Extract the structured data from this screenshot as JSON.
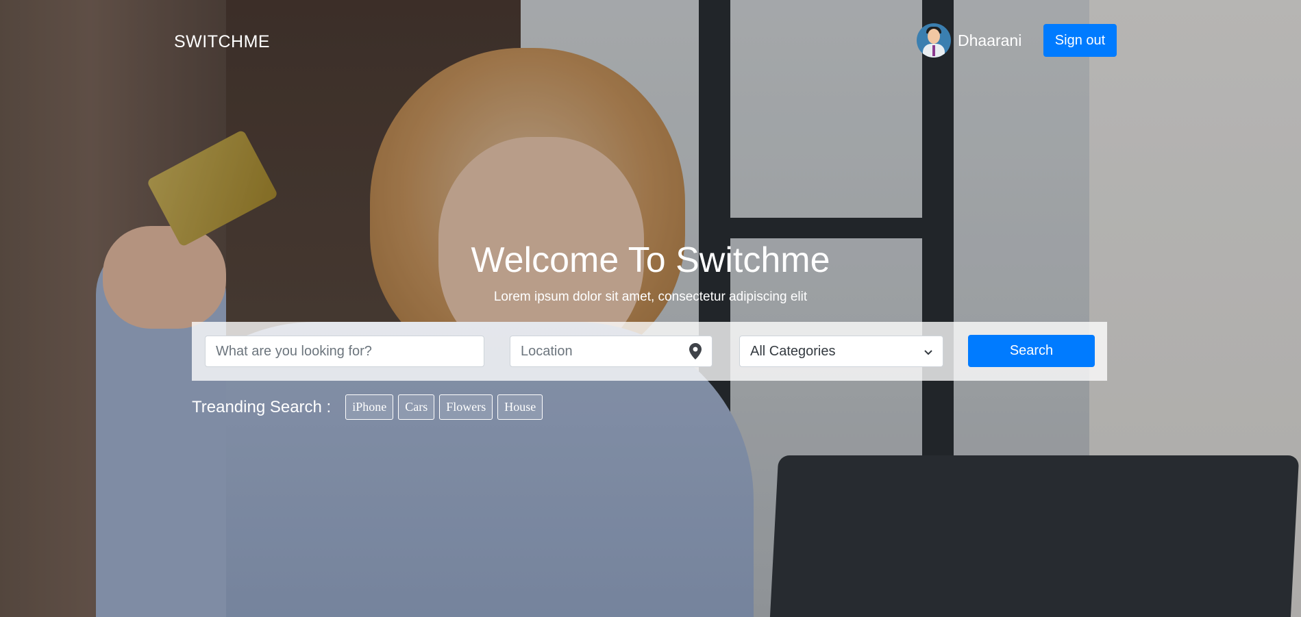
{
  "header": {
    "brand": "SWITCHME",
    "user_name": "Dhaarani",
    "signout_label": "Sign out"
  },
  "hero": {
    "title": "Welcome To Switchme",
    "subtitle": "Lorem ipsum dolor sit amet, consectetur adipiscing elit"
  },
  "search": {
    "what_placeholder": "What are you looking for?",
    "location_placeholder": "Location",
    "category_selected": "All Categories",
    "button_label": "Search"
  },
  "trending": {
    "label": "Treanding Search :",
    "tags": [
      "iPhone",
      "Cars",
      "Flowers",
      "House"
    ]
  },
  "colors": {
    "primary": "#007bff",
    "text_light": "#ffffff"
  },
  "icons": {
    "location": "map-pin-icon",
    "category_dropdown": "chevron-down-icon",
    "avatar": "user-avatar"
  }
}
